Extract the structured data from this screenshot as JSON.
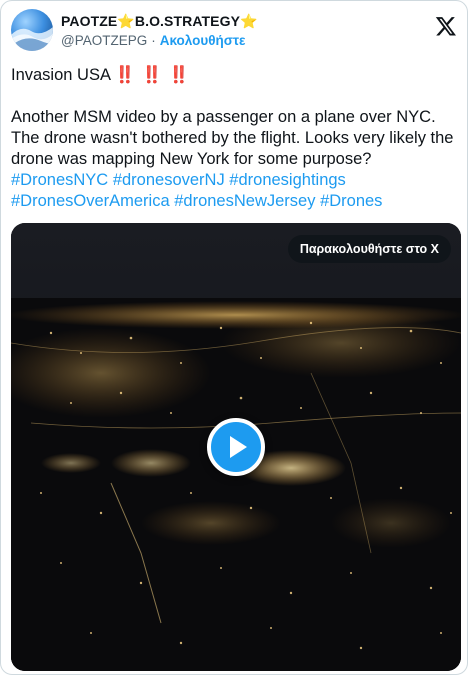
{
  "author": {
    "display_name": "PAOTZE⭐B.O.STRATEGY⭐",
    "handle": "@PAOTZEPG",
    "separator": "·",
    "follow_label": "Ακολουθήστε"
  },
  "tweet": {
    "line1_prefix": "Invasion USA",
    "line1_bangs": "‼️ ‼️ ‼️",
    "body": "Another MSM video by a passenger on a plane over NYC. The drone wasn't bothered by the flight. Looks very likely the drone was mapping New York for some purpose?",
    "hashtags": [
      "#DronesNYC",
      "#dronesoverNJ",
      "#dronesightings",
      "#DronesOverAmerica",
      "#dronesNewJersey",
      "#Drones"
    ]
  },
  "video": {
    "watch_label": "Παρακολουθήστε στο Χ"
  },
  "colors": {
    "accent": "#1d9bf0",
    "text": "#0f1419",
    "muted": "#536471"
  },
  "icons": {
    "x_logo": "x-logo-icon",
    "play": "play-icon"
  }
}
